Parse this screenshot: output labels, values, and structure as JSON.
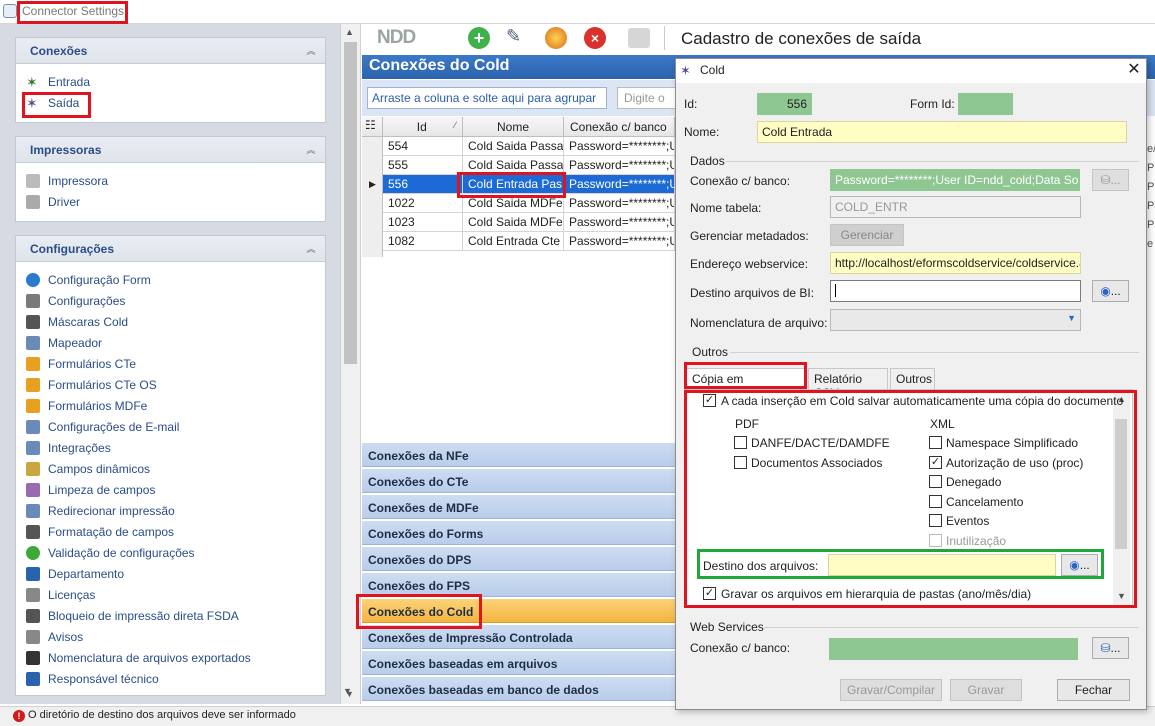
{
  "window": {
    "title": "Connector Settings"
  },
  "sidebar": {
    "groups": [
      {
        "title": "Conexões",
        "items": [
          {
            "label": "Entrada",
            "icon": "connector-in-icon"
          },
          {
            "label": "Saída",
            "icon": "connector-out-icon"
          }
        ]
      },
      {
        "title": "Impressoras",
        "items": [
          {
            "label": "Impressora",
            "icon": "printer-icon"
          },
          {
            "label": "Driver",
            "icon": "driver-icon"
          }
        ]
      },
      {
        "title": "Configurações",
        "items": [
          {
            "label": "Configuração Form",
            "icon": "gear-blue-icon"
          },
          {
            "label": "Configurações",
            "icon": "settings-icon"
          },
          {
            "label": "Máscaras Cold",
            "icon": "mask-icon"
          },
          {
            "label": "Mapeador",
            "icon": "mapper-icon"
          },
          {
            "label": "Formulários CTe",
            "icon": "user-form-icon"
          },
          {
            "label": "Formulários CTe OS",
            "icon": "user-form-icon"
          },
          {
            "label": "Formulários MDFe",
            "icon": "user-form-icon"
          },
          {
            "label": "Configurações de E-mail",
            "icon": "email-icon"
          },
          {
            "label": "Integrações",
            "icon": "integration-icon"
          },
          {
            "label": "Campos dinâmicos",
            "icon": "dynamic-fields-icon"
          },
          {
            "label": "Limpeza de campos",
            "icon": "eraser-icon"
          },
          {
            "label": "Redirecionar impressão",
            "icon": "redirect-icon"
          },
          {
            "label": "Formatação de campos",
            "icon": "format-icon"
          },
          {
            "label": "Validação de configurações",
            "icon": "check-circle-icon"
          },
          {
            "label": "Departamento",
            "icon": "department-icon"
          },
          {
            "label": "Licenças",
            "icon": "license-icon"
          },
          {
            "label": "Bloqueio de impressão direta FSDA",
            "icon": "print-block-icon"
          },
          {
            "label": "Avisos",
            "icon": "mail-icon"
          },
          {
            "label": "Nomenclatura de arquivos exportados",
            "icon": "letter-a-icon"
          },
          {
            "label": "Responsável técnico",
            "icon": "id-card-icon"
          }
        ]
      }
    ]
  },
  "toolbar": {
    "logo": "NDD",
    "heading": "Cadastro de conexões de saída"
  },
  "panel": {
    "title": "Conexões do Cold",
    "group_hint": "Arraste a coluna e solte aqui para agrupar",
    "filter_placeholder": "Digite o n",
    "columns": [
      "Id",
      "Nome",
      "Conexão c/ banco"
    ],
    "rows": [
      {
        "id": "554",
        "nome": "Cold Saida Passa",
        "conexao": "Password=********;U"
      },
      {
        "id": "555",
        "nome": "Cold Saida Passa",
        "conexao": "Password=********;U"
      },
      {
        "id": "556",
        "nome": "Cold Entrada Pas",
        "conexao": "Password=********;U"
      },
      {
        "id": "1022",
        "nome": "Cold Saida MDFe",
        "conexao": "Password=********;U"
      },
      {
        "id": "1023",
        "nome": "Cold Saida MDFe",
        "conexao": "Password=********;U"
      },
      {
        "id": "1082",
        "nome": "Cold Entrada Cte",
        "conexao": "Password=********;U"
      }
    ],
    "right_fragments": [
      "e/",
      "P",
      "P",
      "Pa",
      "Pa",
      "e"
    ]
  },
  "accordion": [
    "Conexões da NFe",
    "Conexões do CTe",
    "Conexões de MDFe",
    "Conexões do Forms",
    "Conexões do DPS",
    "Conexões do FPS",
    "Conexões do Cold",
    "Conexões de Impressão Controlada",
    "Conexões baseadas em arquivos",
    "Conexões baseadas em banco de dados"
  ],
  "status": {
    "message": "O diretório de destino dos arquivos deve ser informado"
  },
  "dialog": {
    "title": "Cold",
    "id_label": "Id:",
    "id_value": "556",
    "formid_label": "Form Id:",
    "formid_value": "",
    "nome_label": "Nome:",
    "nome_value": "Cold Entrada",
    "dados_label": "Dados",
    "conexao_label": "Conexão c/ banco:",
    "conexao_value": "Password=********;User ID=ndd_cold;Data Sour",
    "tabela_label": "Nome tabela:",
    "tabela_value": "COLD_ENTR",
    "metadados_label": "Gerenciar metadados:",
    "gerenciar_btn": "Gerenciar",
    "webservice_label": "Endereço webservice:",
    "webservice_value": "http://localhost/eformscoldservice/coldservice.as",
    "destino_bi_label": "Destino arquivos de BI:",
    "destino_bi_value": "",
    "nomenclatura_label": "Nomenclatura de arquivo:",
    "nomenclatura_value": "",
    "outros_label": "Outros",
    "tabs": [
      "Cópia em repositório",
      "Relatório CSV",
      "Outros"
    ],
    "copia": {
      "auto_copy_label": "A cada inserção em Cold salvar automaticamente uma cópia do documento",
      "pdf_label": "PDF",
      "xml_label": "XML",
      "pdf_options": [
        {
          "label": "DANFE/DACTE/DAMDFE",
          "checked": false
        },
        {
          "label": "Documentos Associados",
          "checked": false
        }
      ],
      "xml_options": [
        {
          "label": "Namespace Simplificado",
          "checked": false
        },
        {
          "label": "Autorização de uso (proc)",
          "checked": true
        },
        {
          "label": "Denegado",
          "checked": false
        },
        {
          "label": "Cancelamento",
          "checked": false
        },
        {
          "label": "Eventos",
          "checked": false
        },
        {
          "label": "Inutilização",
          "checked": false
        }
      ],
      "destino_label": "Destino dos arquivos:",
      "destino_value": "",
      "hierarquia_label": "Gravar os arquivos em hierarquia de pastas (ano/mês/dia)"
    },
    "ws_group_label": "Web Services",
    "ws_conexao_label": "Conexão c/ banco:",
    "ws_conexao_value": "",
    "btn_gravar_compilar": "Gravar/Compilar",
    "btn_gravar": "Gravar",
    "btn_fechar": "Fechar",
    "browse_btn": "..."
  },
  "colors": {
    "accent": "#2b63ad",
    "highlight": "#e0141e",
    "selected_row": "#1c6ad6",
    "active_tab": "#f5b43f"
  }
}
